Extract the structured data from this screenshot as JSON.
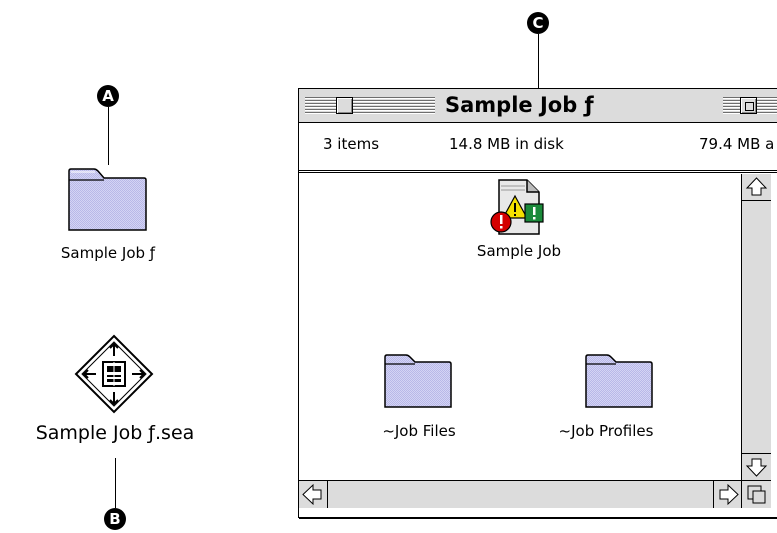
{
  "markers": {
    "a": "A",
    "b": "B",
    "c": "C"
  },
  "desktop": {
    "folder_label": "Sample Job ƒ",
    "archive_label": "Sample Job ƒ.sea"
  },
  "window": {
    "title": "Sample Job ƒ",
    "info": {
      "items": "3 items",
      "disk": "14.8 MB in disk",
      "available": "79.4 MB a"
    },
    "items": [
      {
        "label": "Sample Job",
        "icon": "job-document-icon"
      },
      {
        "label": "~Job Files",
        "icon": "folder-icon"
      },
      {
        "label": "~Job Profiles",
        "icon": "folder-icon"
      }
    ]
  },
  "colors": {
    "folder_fill": "#c8c8f0",
    "window_chrome": "#dcdcdc"
  }
}
